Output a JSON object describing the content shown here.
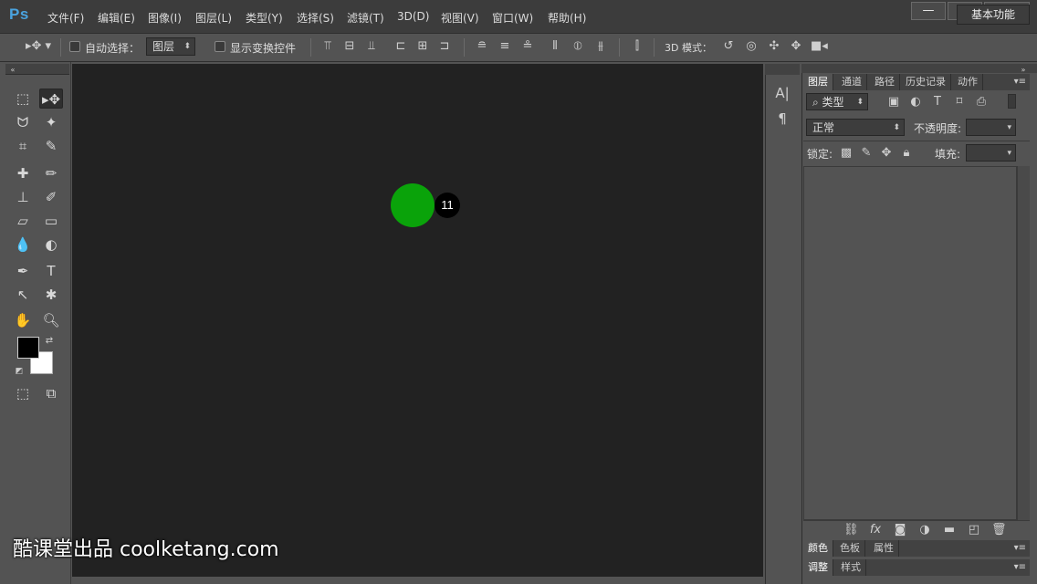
{
  "app": {
    "logo": "Ps"
  },
  "menu": [
    "文件(F)",
    "编辑(E)",
    "图像(I)",
    "图层(L)",
    "类型(Y)",
    "选择(S)",
    "滤镜(T)",
    "3D(D)",
    "视图(V)",
    "窗口(W)",
    "帮助(H)"
  ],
  "window_controls": {
    "minimize": "—",
    "restore": "□",
    "close": "✕"
  },
  "options_bar": {
    "auto_select_label": "自动选择：",
    "auto_select_value": "图层",
    "show_transform_label": "显示变换控件",
    "mode_3d_label": "3D 模式：",
    "workspace_label": "基本功能"
  },
  "canvas": {
    "step_number": "11",
    "marker_color": "#0aa30a"
  },
  "colors": {
    "foreground": "#000000",
    "background": "#ffffff"
  },
  "layers_panel": {
    "tabs": [
      "图层",
      "通道",
      "路径",
      "历史记录",
      "动作"
    ],
    "filter_label": "类型",
    "blend_mode": "正常",
    "opacity_label": "不透明度:",
    "lock_label": "锁定:",
    "fill_label": "填充:"
  },
  "color_panel": {
    "tabs": [
      "颜色",
      "色板",
      "属性"
    ]
  },
  "adjust_panel": {
    "tabs": [
      "调整",
      "样式"
    ]
  },
  "watermark": "酷课堂出品 coolketang.com"
}
